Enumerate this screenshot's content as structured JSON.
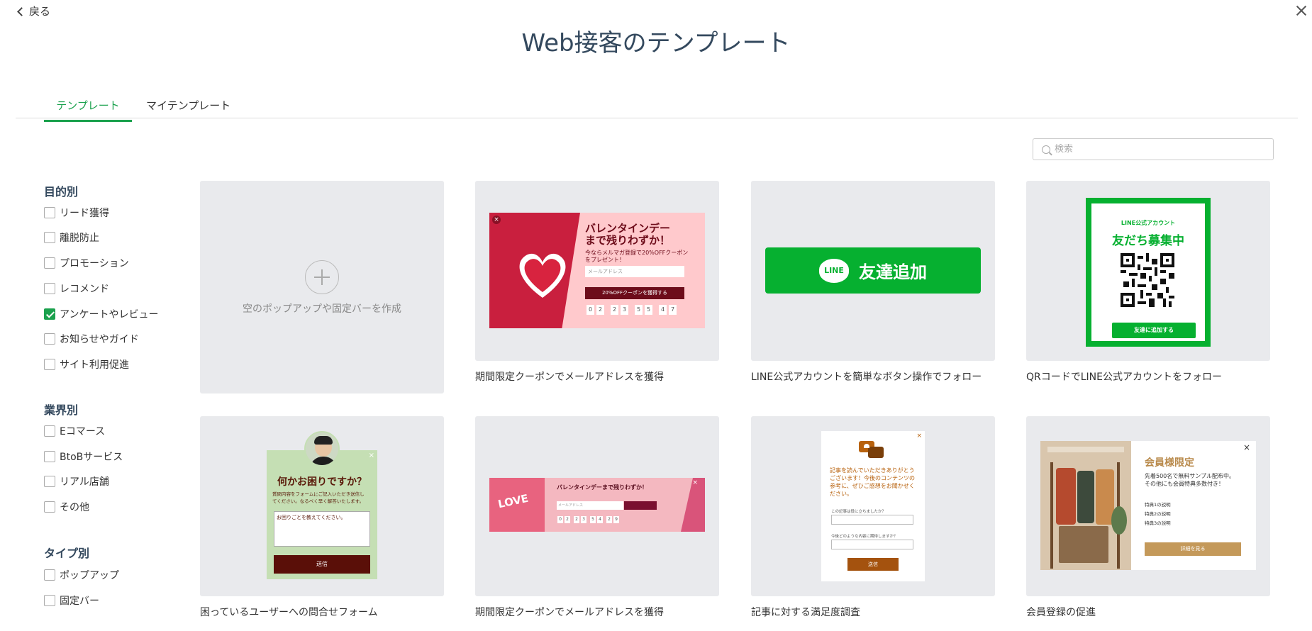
{
  "header": {
    "back_label": "戻る",
    "title": "Web接客のテンプレート"
  },
  "tabs": [
    {
      "label": "テンプレート",
      "active": true
    },
    {
      "label": "マイテンプレート",
      "active": false
    }
  ],
  "search": {
    "placeholder": "検索"
  },
  "filters": {
    "purpose": {
      "title": "目的別",
      "items": [
        {
          "label": "リード獲得",
          "checked": false
        },
        {
          "label": "離脱防止",
          "checked": false
        },
        {
          "label": "プロモーション",
          "checked": false
        },
        {
          "label": "レコメンド",
          "checked": false
        },
        {
          "label": "アンケートやレビュー",
          "checked": true
        },
        {
          "label": "お知らせやガイド",
          "checked": false
        },
        {
          "label": "サイト利用促進",
          "checked": false
        }
      ]
    },
    "industry": {
      "title": "業界別",
      "items": [
        {
          "label": "Eコマース",
          "checked": false
        },
        {
          "label": "BtoBサービス",
          "checked": false
        },
        {
          "label": "リアル店舗",
          "checked": false
        },
        {
          "label": "その他",
          "checked": false
        }
      ]
    },
    "type": {
      "title": "タイプ別",
      "items": [
        {
          "label": "ポップアップ",
          "checked": false
        },
        {
          "label": "固定バー",
          "checked": false
        }
      ]
    }
  },
  "empty_card": {
    "label": "空のポップアップや固定バーを作成"
  },
  "cards": [
    {
      "caption": "期間限定クーポンでメールアドレスを獲得",
      "preview": {
        "heading1": "バレンタインデー",
        "heading2": "まで残りわずか！",
        "sub": "今ならメルマガ登録で20%OFFクーポン",
        "sub2": "をプレゼント！",
        "email_placeholder": "メールアドレス",
        "button": "20%OFFクーポンを獲得する",
        "digits": [
          "0",
          "2",
          "2",
          "3",
          "5",
          "5",
          "4",
          "7"
        ]
      }
    },
    {
      "caption": "LINE公式アカウントを簡単なボタン操作でフォロー",
      "preview": {
        "logo": "LINE",
        "button": "友達追加"
      }
    },
    {
      "caption": "QRコードでLINE公式アカウントをフォロー",
      "preview": {
        "top": "LINE公式アカウント",
        "heading": "友だち募集中",
        "button": "友達に追加する"
      }
    },
    {
      "caption": "困っているユーザーへの問合せフォーム",
      "preview": {
        "heading": "何かお困りですか？",
        "sub": "質問内容をフォームにご記入いただき送信し",
        "sub2": "てください。なるべく早く解答いたします。",
        "textarea": "お困りごとを教えてください。",
        "button": "送信"
      }
    },
    {
      "caption": "期間限定クーポンでメールアドレスを獲得",
      "preview": {
        "heading": "バレンタインデーまで残りわずか！",
        "email_placeholder": "メールアドレス",
        "digits": [
          "0",
          "2",
          "2",
          "3",
          "5",
          "4",
          "2",
          "9"
        ],
        "love": "LOVE"
      }
    },
    {
      "caption": "記事に対する満足度調査",
      "preview": {
        "text": "記事を読んでいただきありがとうございます！今後のコンテンツの参考に、ぜひご感想をお聞かせください。",
        "q1": "この記事は役に立ちましたか？",
        "q2": "今後どのような内容に期待しますか？",
        "button": "送信"
      }
    },
    {
      "caption": "会員登録の促進",
      "preview": {
        "heading": "会員様限定",
        "sub": "先着500名で無料サンプル配布中。",
        "sub2": "その他にも会員特典多数付き！",
        "b1": "特典1の説明",
        "b2": "特典2の説明",
        "b3": "特典3の説明",
        "button": "詳細を見る"
      }
    }
  ]
}
